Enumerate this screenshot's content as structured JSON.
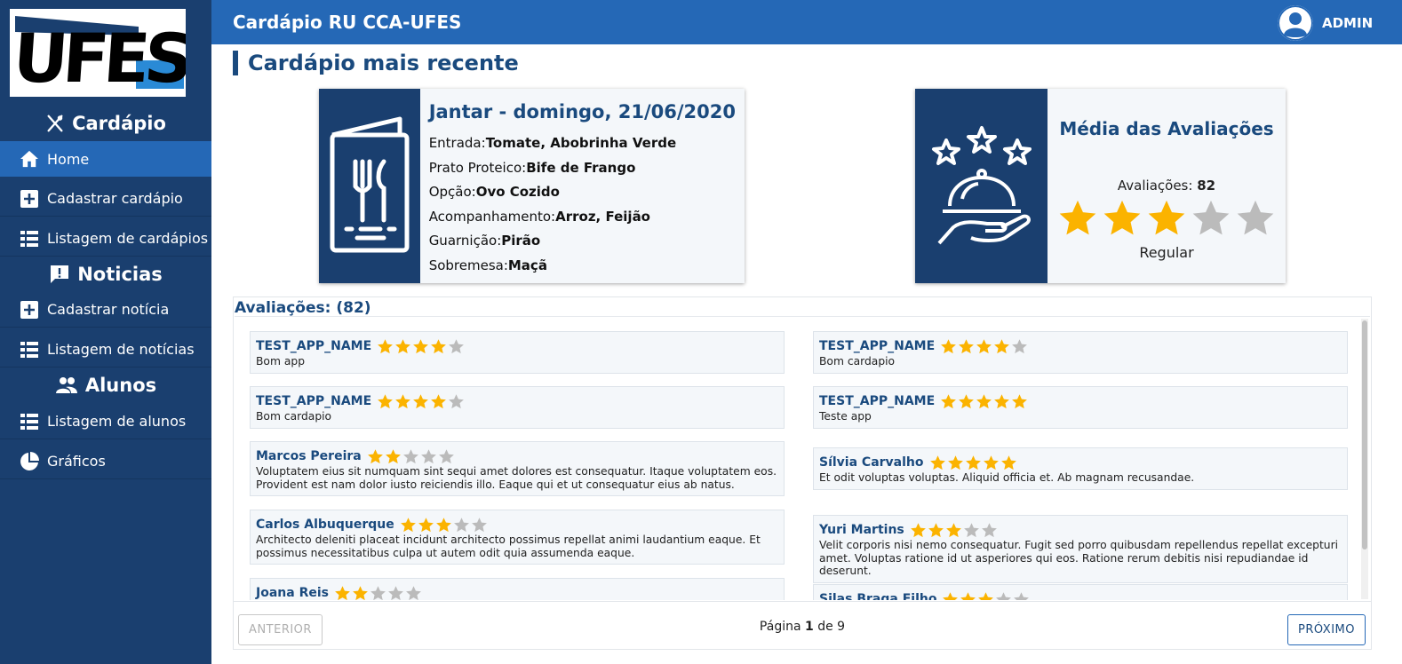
{
  "colors": {
    "sidebar": "#1a3f6f",
    "topbar": "#2568b6",
    "accent": "#1a4a7e",
    "star_on": "#fbb300",
    "star_off": "#bbbbbb"
  },
  "brand": {
    "logo_text": "UFES"
  },
  "sidebar": {
    "sections": [
      {
        "title": "Cardápio",
        "icon": "utensils-icon"
      },
      {
        "title": "Noticias",
        "icon": "message-alert-icon"
      },
      {
        "title": "Alunos",
        "icon": "people-icon"
      }
    ],
    "items": [
      {
        "label": "Home",
        "icon": "home-icon",
        "active": true
      },
      {
        "label": "Cadastrar cardápio",
        "icon": "plus-box-icon"
      },
      {
        "label": "Listagem de cardápios",
        "icon": "list-icon"
      },
      {
        "label": "Cadastrar notícia",
        "icon": "plus-box-icon"
      },
      {
        "label": "Listagem de notícias",
        "icon": "list-icon"
      },
      {
        "label": "Listagem de alunos",
        "icon": "list-icon"
      },
      {
        "label": "Gráficos",
        "icon": "pie-chart-icon"
      }
    ]
  },
  "header": {
    "title": "Cardápio RU CCA-UFES",
    "user": "ADMIN"
  },
  "page": {
    "title": "Cardápio mais recente"
  },
  "menu": {
    "title": "Jantar - domingo, 21/06/2020",
    "lines": [
      {
        "label": "Entrada:",
        "value": "Tomate, Abobrinha Verde"
      },
      {
        "label": "Prato Proteico:",
        "value": "Bife de Frango"
      },
      {
        "label": "Opção:",
        "value": "Ovo Cozido"
      },
      {
        "label": "Acompanhamento:",
        "value": "Arroz, Feijão"
      },
      {
        "label": "Guarnição:",
        "value": "Pirão"
      },
      {
        "label": "Sobremesa:",
        "value": "Maçã"
      }
    ]
  },
  "rating": {
    "title": "Média das Avaliações",
    "count_label": "Avaliações:",
    "count": "82",
    "stars": 3,
    "max_stars": 5,
    "label": "Regular"
  },
  "reviews": {
    "header": "Avaliações: (82)",
    "left": [
      {
        "author": "TEST_APP_NAME",
        "stars": 4,
        "comment": "Bom app"
      },
      {
        "author": "TEST_APP_NAME",
        "stars": 4,
        "comment": "Bom cardapio"
      },
      {
        "author": "Marcos Pereira",
        "stars": 2,
        "comment": "Voluptatem eius sit numquam sint sequi amet dolores est consequatur. Itaque voluptatem eos. Provident est nam dolor iusto reiciendis illo. Eaque qui et ut consequatur eius ab natus."
      },
      {
        "author": "Carlos Albuquerque",
        "stars": 3,
        "comment": "Architecto deleniti placeat incidunt architecto possimus repellat animi laudantium eaque. Et possimus necessitatibus culpa ut autem odit quia assumenda eaque."
      },
      {
        "author": "Joana Reis",
        "stars": 2,
        "comment": ""
      }
    ],
    "right": [
      {
        "author": "TEST_APP_NAME",
        "stars": 4,
        "comment": "Bom cardapio"
      },
      {
        "author": "TEST_APP_NAME",
        "stars": 5,
        "comment": "Teste app"
      },
      {
        "author": "Sílvia Carvalho",
        "stars": 5,
        "comment": "Et odit voluptas voluptas. Aliquid officia et. Ab magnam recusandae."
      },
      {
        "author": "Yuri Martins",
        "stars": 3,
        "comment": "Velit corporis nisi nemo consequatur. Fugit sed porro quibusdam repellendus repellat excepturi amet. Voluptas ratione id ut asperiores qui eos. Ratione rerum debitis nisi repudiandae id deserunt."
      },
      {
        "author": "Silas Braga Filho",
        "stars": 3,
        "comment": ""
      }
    ]
  },
  "pagination": {
    "prev": "ANTERIOR",
    "next": "PRÓXIMO",
    "page_word": "Página",
    "current": "1",
    "of_word": "de",
    "total": "9"
  }
}
